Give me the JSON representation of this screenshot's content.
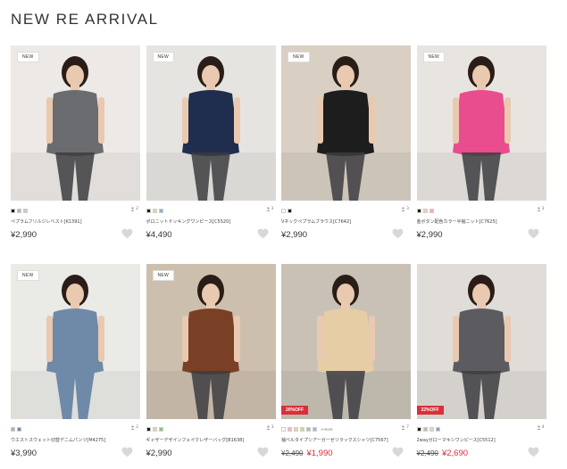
{
  "section": {
    "title": "NEW RE ARRIVAL"
  },
  "products": [
    {
      "name": "ペプラムフリルジレベスト[K1391]",
      "price": "¥2,990",
      "badge": "NEW",
      "count": "2",
      "swatches": [
        "#1a1a1a",
        "#b5b5b5",
        "#d8c9b3"
      ],
      "bg": "#ece9e6",
      "item": "#6b6c70"
    },
    {
      "name": "ポロニットドッキングワンピース[C5520]",
      "price": "¥4,490",
      "badge": "NEW",
      "count": "3",
      "swatches": [
        "#1a1a1a",
        "#e9d6a2",
        "#8fb0cf"
      ],
      "bg": "#e6e4e0",
      "item": "#1f2d4e"
    },
    {
      "name": "Vネックペプラムブラウス[C7642]",
      "price": "¥2,990",
      "badge": "NEW",
      "count": "3",
      "swatches": [
        "#ffffff",
        "#1a1a1a"
      ],
      "bg": "#d9cfc3",
      "item": "#1d1d1d"
    },
    {
      "name": "金ボタン配色カラー半袖ニット[C7625]",
      "price": "¥2,990",
      "badge": "NEW",
      "count": "3",
      "swatches": [
        "#1a1a1a",
        "#e9d6a2",
        "#f0a9c6"
      ],
      "bg": "#e8e5e1",
      "item": "#e94d8e"
    },
    {
      "name": "ウエストスウェット切替デニムパンツ[M4275]",
      "price": "¥3,990",
      "badge": "NEW",
      "count": "2",
      "swatches": [
        "#a9b4c2",
        "#6f87a8"
      ],
      "bg": "#eaeae7",
      "item": "#6f8aa8"
    },
    {
      "name": "ギャザーデザインフェイクレザーバッグ[B1638]",
      "price": "¥2,990",
      "badge": "NEW",
      "count": "3",
      "swatches": [
        "#1a1a1a",
        "#e9d6a2",
        "#8cc08a"
      ],
      "bg": "#cdbfae",
      "item": "#7a4025"
    },
    {
      "name": "袖ベルタイプシアーガーゼリラックスシャツ[C7567]",
      "price": "¥1,990",
      "old_price": "¥2,490",
      "sale_badge": "20%OFF",
      "count": "7",
      "swatches": [
        "#ffffff",
        "#f1b4c6",
        "#e9d6a2",
        "#cfd7a6",
        "#9cc7a3",
        "#a8b6cf"
      ],
      "more": "+more",
      "bg": "#c9c1b6",
      "item": "#e6cda6"
    },
    {
      "name": "2wayガローマキシワンピース[C5512]",
      "price": "¥2,690",
      "old_price": "¥2,490",
      "sale_badge": "22%OFF",
      "count": "4",
      "swatches": [
        "#1a1a1a",
        "#c9b8a3",
        "#d8d8d8",
        "#8aa0c0"
      ],
      "bg": "#e0ddd8",
      "item": "#5c5c60"
    }
  ],
  "icons": {
    "heart": "heart-icon",
    "person": "person-icon"
  }
}
